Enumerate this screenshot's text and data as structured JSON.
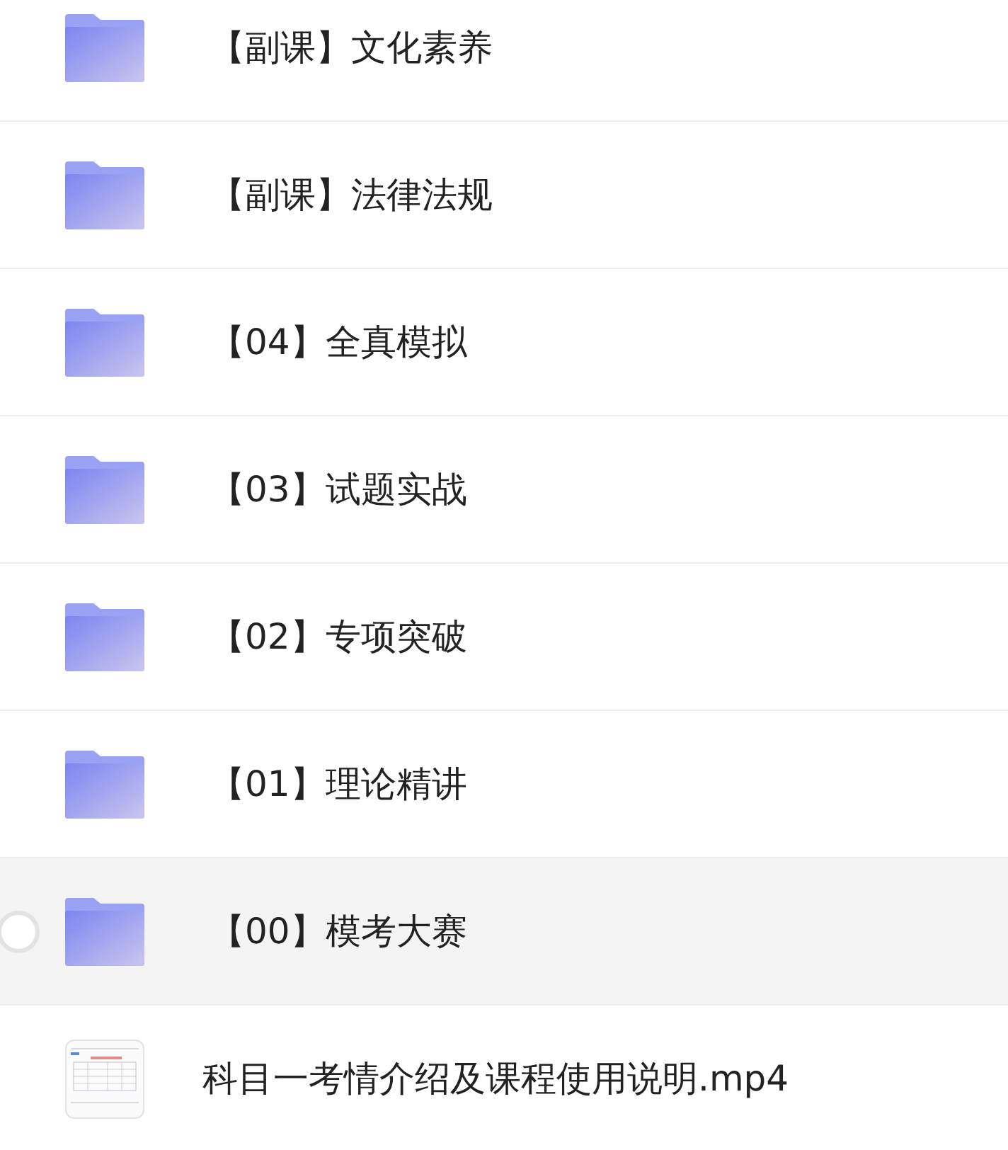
{
  "files": [
    {
      "kind": "folder",
      "name": "【副课】文化素养",
      "selected": false
    },
    {
      "kind": "folder",
      "name": "【副课】法律法规",
      "selected": false
    },
    {
      "kind": "folder",
      "name": "【04】全真模拟",
      "selected": false
    },
    {
      "kind": "folder",
      "name": "【03】试题实战",
      "selected": false
    },
    {
      "kind": "folder",
      "name": "【02】专项突破",
      "selected": false
    },
    {
      "kind": "folder",
      "name": "【01】理论精讲",
      "selected": false
    },
    {
      "kind": "folder",
      "name": "【00】模考大赛",
      "selected": true
    },
    {
      "kind": "video",
      "name": "科目一考情介绍及课程使用说明.mp4",
      "selected": false
    }
  ]
}
